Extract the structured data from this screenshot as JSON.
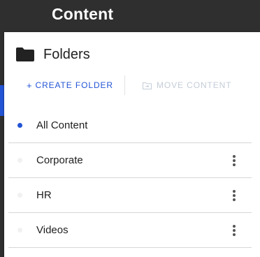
{
  "header": {
    "title": "Content"
  },
  "panel": {
    "title": "Folders",
    "icon": "folder-icon",
    "actions": {
      "create_label": "CREATE FOLDER",
      "create_prefix": "+",
      "move_label": "MOVE CONTENT",
      "move_icon": "move-folder-icon"
    },
    "folders": [
      {
        "label": "All Content",
        "selected": true,
        "has_menu": false
      },
      {
        "label": "Corporate",
        "selected": false,
        "has_menu": true
      },
      {
        "label": "HR",
        "selected": false,
        "has_menu": true
      },
      {
        "label": "Videos",
        "selected": false,
        "has_menu": true
      }
    ]
  },
  "colors": {
    "accent": "#2354d6",
    "header_bg": "#2f2f2f",
    "disabled_text": "#c4cdd8",
    "divider": "#d6d6d6"
  }
}
